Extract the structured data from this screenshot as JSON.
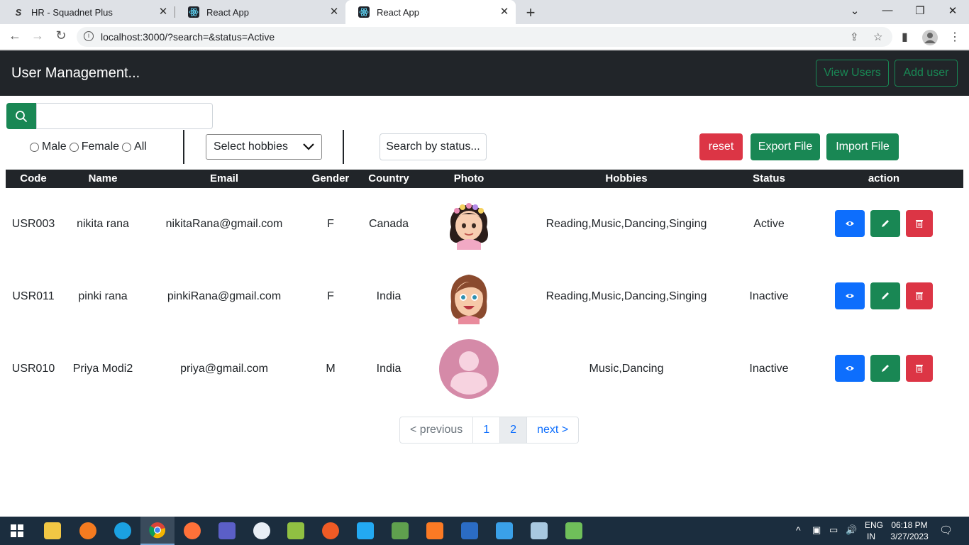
{
  "browser": {
    "tabs": [
      {
        "title": "HR - Squadnet Plus",
        "icon": "squadnet-icon",
        "active": false
      },
      {
        "title": "React App",
        "icon": "react-icon",
        "active": false
      },
      {
        "title": "React App",
        "icon": "react-icon",
        "active": true
      }
    ],
    "url": "localhost:3000/?search=&status=Active"
  },
  "app": {
    "brand": "User Management...",
    "nav": {
      "view_users": "View Users",
      "add_user": "Add user"
    }
  },
  "filters": {
    "search_value": "",
    "gender_options": [
      "Male",
      "Female",
      "All"
    ],
    "hobbies_placeholder": "Select hobbies",
    "status_search": "Search by status...",
    "reset": "reset",
    "export": "Export File",
    "import": "Import File"
  },
  "table": {
    "headers": [
      "Code",
      "Name",
      "Email",
      "Gender",
      "Country",
      "Photo",
      "Hobbies",
      "Status",
      "action"
    ],
    "rows": [
      {
        "code": "USR003",
        "name": "nikita rana",
        "email": "nikitaRana@gmail.com",
        "gender": "F",
        "country": "Canada",
        "photo": "girl-flower-crown-avatar",
        "hobbies": "Reading,Music,Dancing,Singing",
        "status": "Active"
      },
      {
        "code": "USR011",
        "name": "pinki rana",
        "email": "pinkiRana@gmail.com",
        "gender": "F",
        "country": "India",
        "photo": "girl-cartoon-avatar",
        "hobbies": "Reading,Music,Dancing,Singing",
        "status": "Inactive"
      },
      {
        "code": "USR010",
        "name": "Priya Modi2",
        "email": "priya@gmail.com",
        "gender": "M",
        "country": "India",
        "photo": "default-user-avatar",
        "hobbies": "Music,Dancing",
        "status": "Inactive"
      }
    ]
  },
  "pagination": {
    "previous": "< previous",
    "pages": [
      "1",
      "2"
    ],
    "current": "2",
    "next": "next >"
  },
  "taskbar": {
    "lang1": "ENG",
    "lang2": "IN",
    "time": "06:18 PM",
    "date": "3/27/2023"
  },
  "colors": {
    "navbar": "#212529",
    "success": "#198754",
    "danger": "#dc3545",
    "primary": "#0d6efd"
  }
}
